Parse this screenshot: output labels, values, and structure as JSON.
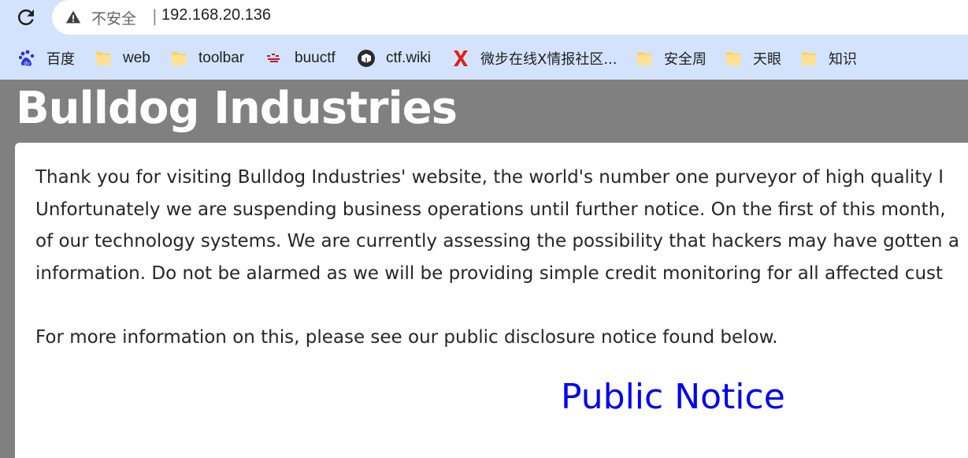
{
  "browser": {
    "security_label": "不安全",
    "separator": "|",
    "url": "192.168.20.136",
    "icons": [
      "reload-icon",
      "warning-icon",
      "share-icon"
    ],
    "bookmarks": [
      {
        "label": "百度",
        "icon": "baidu-icon"
      },
      {
        "label": "web",
        "icon": "folder-icon"
      },
      {
        "label": "toolbar",
        "icon": "folder-icon"
      },
      {
        "label": "buuctf",
        "icon": "buuctf-icon"
      },
      {
        "label": "ctf.wiki",
        "icon": "ctfwiki-icon"
      },
      {
        "label": "微步在线X情报社区...",
        "icon": "threatbook-x-icon"
      },
      {
        "label": "安全周",
        "icon": "folder-icon"
      },
      {
        "label": "天眼",
        "icon": "folder-icon"
      },
      {
        "label": "知识",
        "icon": "folder-icon"
      }
    ]
  },
  "page": {
    "title": "Bulldog Industries",
    "lines": [
      "Thank you for visiting Bulldog Industries' website, the world's number one purveyor of high quality I",
      "Unfortunately we are suspending business operations until further notice. On the first of this month,",
      "of our technology systems. We are currently assessing the possibility that hackers may have gotten a",
      "information. Do not be alarmed as we will be providing simple credit monitoring for all affected cust"
    ],
    "more_info": "For more information on this, please see our public disclosure notice found below.",
    "notice_link": "Public Notice"
  },
  "colors": {
    "chrome_bg": "#d3e3fd",
    "page_bg": "#808080",
    "link": "#0000ee",
    "text": "#262626"
  }
}
